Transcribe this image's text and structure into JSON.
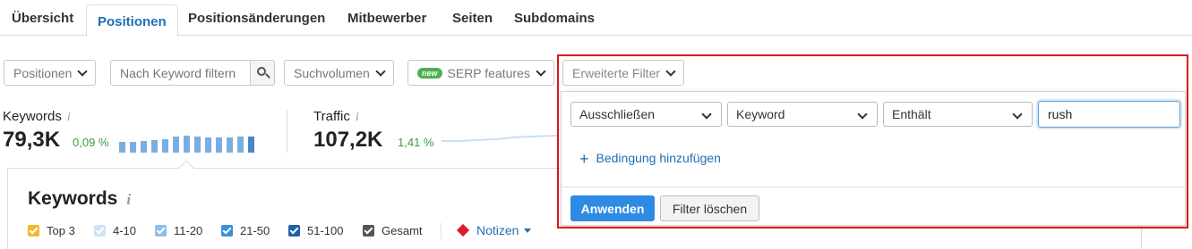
{
  "tabs": [
    {
      "label": "Übersicht"
    },
    {
      "label": "Positionen"
    },
    {
      "label": "Positionsänderungen"
    },
    {
      "label": "Mitbewerber"
    },
    {
      "label": "Seiten"
    },
    {
      "label": "Subdomains"
    }
  ],
  "active_tab": "Positionen",
  "filters": {
    "positions_label": "Positionen",
    "keyword_placeholder": "Nach Keyword filtern",
    "volume_label": "Suchvolumen",
    "serp_badge": "new",
    "serp_label": "SERP features",
    "advanced_label": "Erweiterte Filter"
  },
  "metrics": {
    "keywords": {
      "label": "Keywords",
      "value": "79,3K",
      "delta": "0,09 %"
    },
    "traffic": {
      "label": "Traffic",
      "value": "107,2K",
      "delta": "1,41 %"
    }
  },
  "sparkline_levels": [
    0.6,
    0.6,
    0.65,
    0.7,
    0.75,
    0.9,
    0.95,
    0.9,
    0.85,
    0.85,
    0.85,
    0.9,
    0.9
  ],
  "keywords_panel": {
    "title": "Keywords",
    "legend": [
      {
        "label": "Top 3",
        "color": "#f5b82e"
      },
      {
        "label": "4-10",
        "color": "#cfe3f7"
      },
      {
        "label": "11-20",
        "color": "#8fbfe8"
      },
      {
        "label": "21-50",
        "color": "#3b8fdc"
      },
      {
        "label": "51-100",
        "color": "#1f5fa8"
      },
      {
        "label": "Gesamt",
        "color": "#555555"
      }
    ],
    "notes_label": "Notizen"
  },
  "advanced_filter": {
    "rule": {
      "mode": "Ausschließen",
      "field": "Keyword",
      "operator": "Enthält",
      "value": "rush"
    },
    "add_condition_label": "Bedingung hinzufügen",
    "apply_label": "Anwenden",
    "clear_label": "Filter löschen"
  },
  "colors": {
    "accent": "#1f6fb5",
    "apply_button": "#2e8be3",
    "highlight_border": "#e0111b",
    "positive_delta": "#3c9a3c"
  }
}
